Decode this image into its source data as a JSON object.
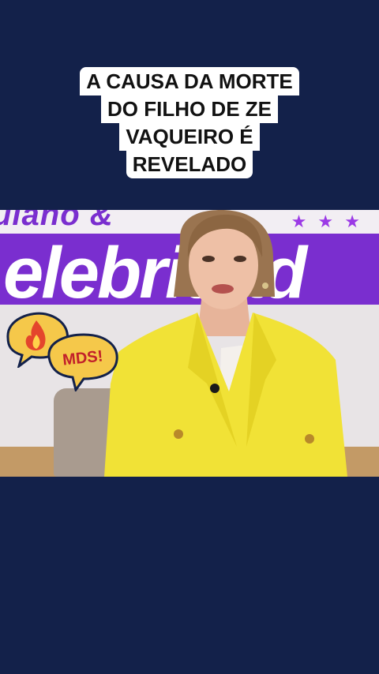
{
  "caption": {
    "lines": [
      "A CAUSA DA MORTE",
      "DO FILHO DE ZE",
      "VAQUEIRO É",
      "REVELADO"
    ]
  },
  "video": {
    "banner_text_top": "ulano & ",
    "banner_text": "elebridad",
    "stars": "★ ★ ★"
  },
  "stickers": {
    "fire_icon": "fire-icon",
    "mds_text": "MDS!"
  },
  "colors": {
    "background": "#13214a",
    "banner": "#7a2ecf",
    "jacket": "#f1e236",
    "sticker": "#f5c84a",
    "sticker_text": "#c2202a"
  }
}
